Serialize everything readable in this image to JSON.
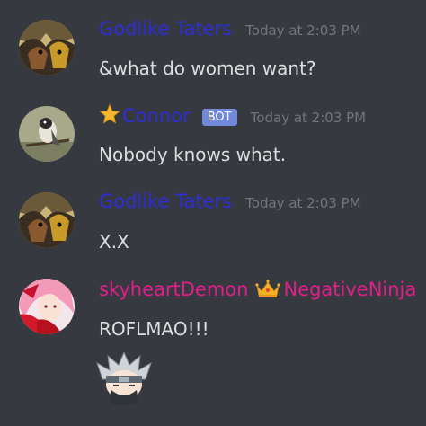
{
  "colors": {
    "background": "#36393f",
    "godlike": "#2d2ed6",
    "connor": "#2d2ed6",
    "sky": "#e01f8a",
    "message_text": "#dcddde",
    "timestamp": "#72767d",
    "bot_badge": "#7289da"
  },
  "messages": [
    {
      "author": "Godlike Taters",
      "timestamp": "Today at 2:03 PM",
      "text": "&what do women want?",
      "avatar_icon": "bat-avatar-icon"
    },
    {
      "author": "Connor",
      "badge": "BOT",
      "timestamp": "Today at 2:03 PM",
      "text": "Nobody knows what.",
      "prefix_icon": "star-icon",
      "avatar_icon": "bird-avatar-icon"
    },
    {
      "author": "Godlike Taters",
      "timestamp": "Today at 2:03 PM",
      "text": "X.X",
      "avatar_icon": "bat-avatar-icon"
    },
    {
      "author": "skyheartDemon",
      "author_extra": "NegativeNinja",
      "text": "ROFLMAO!!!",
      "extra_icon": "crown-icon",
      "avatar_icon": "anime-girl-avatar-icon",
      "emote_icon": "chibi-ninja-emote-icon"
    }
  ]
}
